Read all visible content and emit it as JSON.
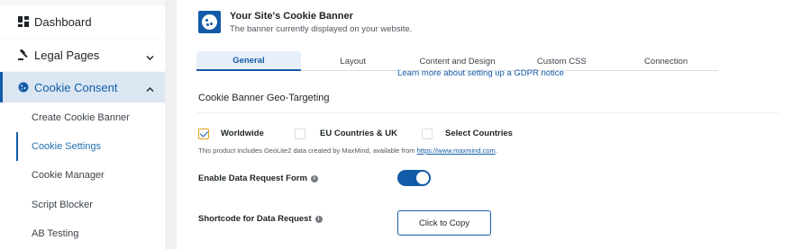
{
  "sidebar": {
    "dashboard": {
      "label": "Dashboard",
      "icon": "dashboard-icon"
    },
    "legal_pages": {
      "label": "Legal Pages",
      "icon": "gavel-icon"
    },
    "cookie_consent": {
      "label": "Cookie Consent",
      "icon": "cookie-icon"
    },
    "submenu": [
      {
        "label": "Create Cookie Banner"
      },
      {
        "label": "Cookie Settings"
      },
      {
        "label": "Cookie Manager"
      },
      {
        "label": "Script Blocker"
      },
      {
        "label": "AB Testing"
      }
    ]
  },
  "header": {
    "title": "Your Site's Cookie Banner",
    "subtitle": "The banner currently displayed on your website."
  },
  "tabs": [
    "General",
    "Layout",
    "Content and Design",
    "Custom CSS",
    "Connection"
  ],
  "gdpr_link": "Learn more about setting up a GDPR notice",
  "geo": {
    "section_title": "Cookie Banner Geo-Targeting",
    "options": [
      {
        "label": "Worldwide",
        "checked": true
      },
      {
        "label": "EU Countries & UK",
        "checked": false
      },
      {
        "label": "Select Countries",
        "checked": false
      }
    ],
    "note_text": "This product includes GeoLite2 data created by MaxMind, available from ",
    "note_link": "https://www.maxmind.com",
    "note_end": "."
  },
  "data_request": {
    "label": "Enable Data Request Form",
    "enabled": true
  },
  "shortcode": {
    "label": "Shortcode for Data Request",
    "button": "Click to Copy"
  },
  "colors": {
    "accent": "#135ba8",
    "checkbox_focus": "#dba617"
  }
}
